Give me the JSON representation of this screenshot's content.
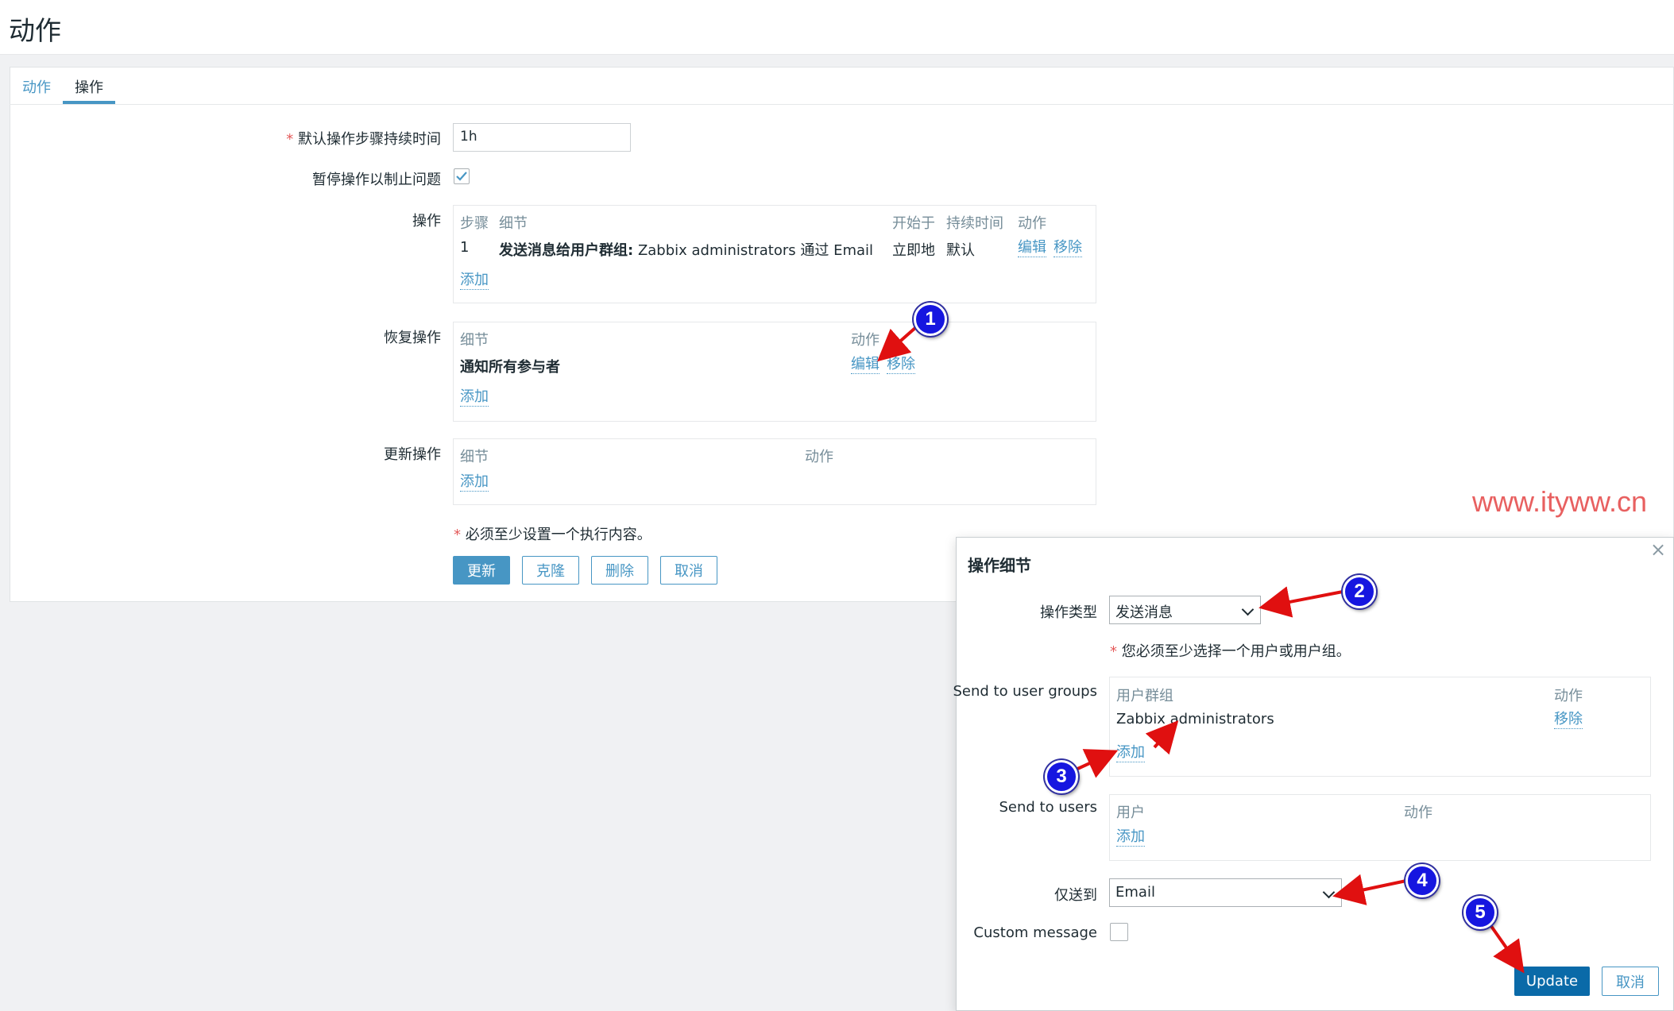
{
  "page": {
    "title": "动作"
  },
  "tabs": [
    {
      "label": "动作"
    },
    {
      "label": "操作"
    }
  ],
  "form": {
    "duration_label": "默认操作步骤持续时间",
    "duration_value": "1h",
    "pause_label": "暂停操作以制止问题",
    "pause_checked": true,
    "operations": {
      "label": "操作",
      "headers": {
        "step": "步骤",
        "detail": "细节",
        "start": "开始于",
        "duration": "持续时间",
        "action": "动作"
      },
      "row": {
        "step": "1",
        "detail_bold": "发送消息给用户群组:",
        "detail_rest": "Zabbix administrators 通过 Email",
        "start": "立即地",
        "duration": "默认",
        "edit": "编辑",
        "remove": "移除"
      },
      "add": "添加"
    },
    "recovery": {
      "label": "恢复操作",
      "headers": {
        "detail": "细节",
        "action": "动作"
      },
      "row": {
        "detail": "通知所有参与者",
        "edit": "编辑",
        "remove": "移除"
      },
      "add": "添加"
    },
    "update_ops": {
      "label": "更新操作",
      "headers": {
        "detail": "细节",
        "action": "动作"
      },
      "add": "添加"
    },
    "note": "必须至少设置一个执行内容。",
    "buttons": {
      "update": "更新",
      "clone": "克隆",
      "delete": "删除",
      "cancel": "取消"
    }
  },
  "watermark": "www.ityww.cn",
  "modal": {
    "title": "操作细节",
    "close": "×",
    "op_type_label": "操作类型",
    "op_type_value": "发送消息",
    "warning": "您必须至少选择一个用户或用户组。",
    "groups_label": "Send to user groups",
    "groups_headers": {
      "group": "用户群组",
      "action": "动作"
    },
    "groups_row": {
      "name": "Zabbix administrators",
      "remove": "移除"
    },
    "groups_add": "添加",
    "users_label": "Send to users",
    "users_headers": {
      "user": "用户",
      "action": "动作"
    },
    "users_add": "添加",
    "send_only_label": "仅送到",
    "send_only_value": "Email",
    "custom_label": "Custom message",
    "custom_checked": false,
    "update_button": "Update",
    "cancel_button": "取消"
  },
  "annotations": {
    "badge1": "1",
    "badge2": "2",
    "badge3": "3",
    "badge4": "4",
    "badge5": "5",
    "arrow_color": "#e01010",
    "badge_color": "#1616e0"
  }
}
